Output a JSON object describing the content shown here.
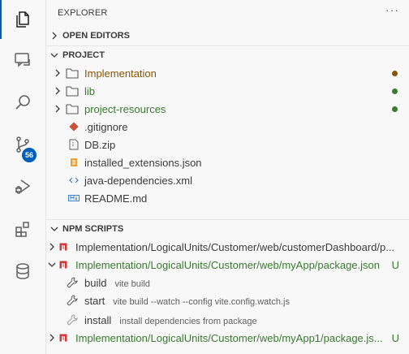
{
  "activity_bar": {
    "items": [
      {
        "icon": "files-icon"
      },
      {
        "icon": "chat-icon"
      },
      {
        "icon": "search-icon"
      },
      {
        "icon": "source-control-icon",
        "badge": "56"
      },
      {
        "icon": "run-debug-icon"
      },
      {
        "icon": "extensions-icon"
      },
      {
        "icon": "database-icon"
      }
    ]
  },
  "sidebar": {
    "title": "EXPLORER",
    "more": "···",
    "open_editors": "OPEN EDITORS",
    "project": {
      "label": "PROJECT",
      "items": [
        {
          "name": "Implementation",
          "type": "folder",
          "color": "#895503",
          "dot": "#895503"
        },
        {
          "name": "lib",
          "type": "folder",
          "color": "#387a2e",
          "dot": "#387a2e"
        },
        {
          "name": "project-resources",
          "type": "folder",
          "color": "#387a2e",
          "dot": "#387a2e"
        },
        {
          "name": ".gitignore",
          "type": "file",
          "icon": "git-file-icon"
        },
        {
          "name": "DB.zip",
          "type": "file",
          "icon": "zip-file-icon"
        },
        {
          "name": "installed_extensions.json",
          "type": "file",
          "icon": "json-file-icon"
        },
        {
          "name": "java-dependencies.xml",
          "type": "file",
          "icon": "xml-file-icon"
        },
        {
          "name": "README.md",
          "type": "file",
          "icon": "markdown-file-icon"
        }
      ]
    },
    "npm_scripts": {
      "label": "NPM SCRIPTS",
      "packages": [
        {
          "path": "Implementation/LogicalUnits/Customer/web/customerDashboard/p...",
          "expanded": false,
          "status": ""
        },
        {
          "path": "Implementation/LogicalUnits/Customer/web/myApp/package.json",
          "expanded": true,
          "status": "U"
        },
        {
          "path": "Implementation/LogicalUnits/Customer/web/myApp1/package.js...",
          "expanded": false,
          "status": "U"
        }
      ],
      "scripts": [
        {
          "name": "build",
          "command": "vite build"
        },
        {
          "name": "start",
          "command": "vite build --watch --config vite.config.watch.js"
        },
        {
          "name": "install",
          "command": "install dependencies from package"
        }
      ]
    }
  }
}
